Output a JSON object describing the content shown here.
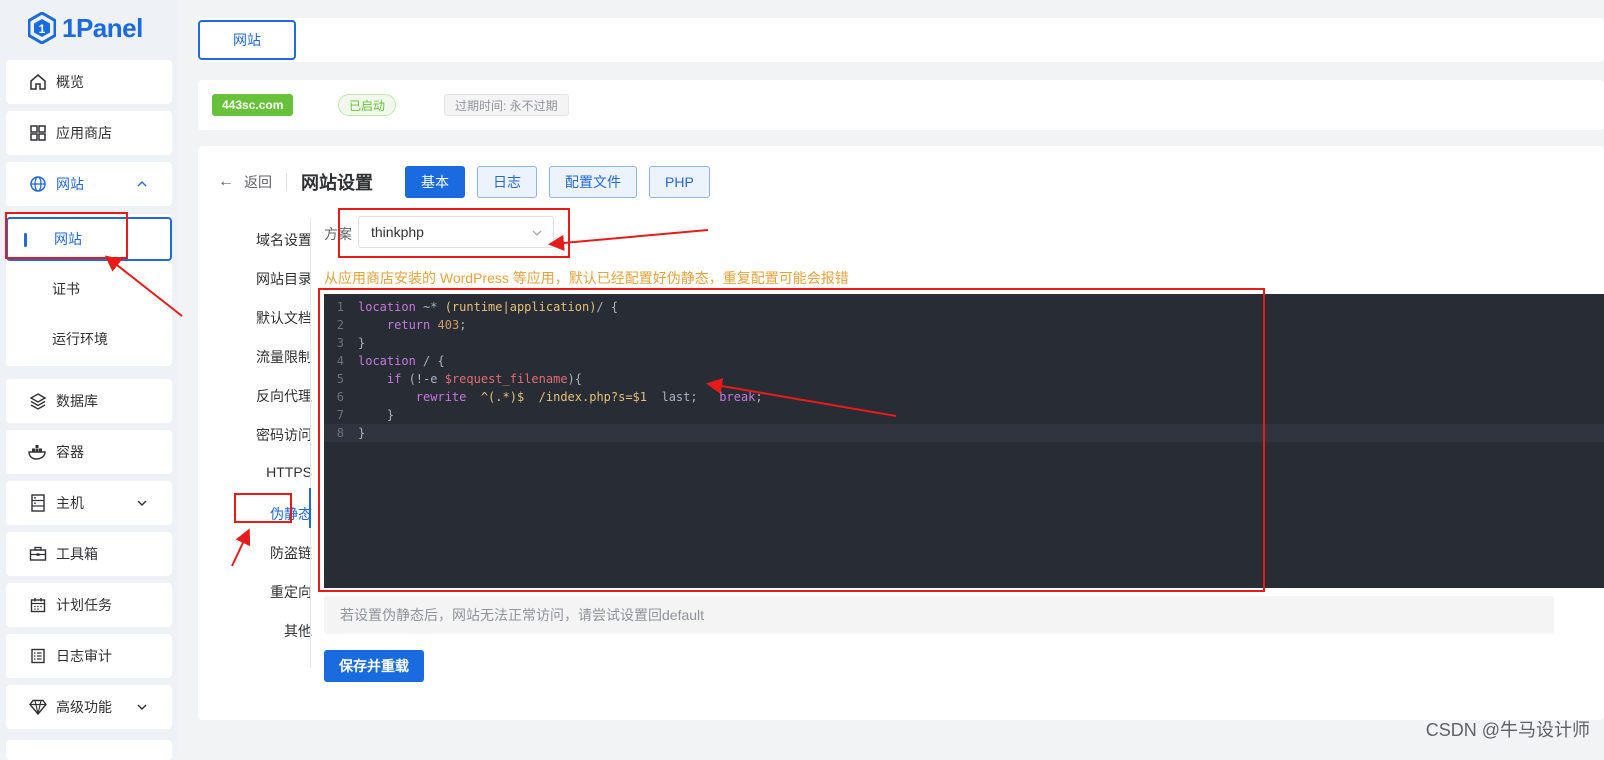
{
  "brand": {
    "name": "1Panel"
  },
  "sidebar": {
    "items": [
      {
        "label": "概览",
        "icon": "home-icon"
      },
      {
        "label": "应用商店",
        "icon": "app-grid-icon"
      },
      {
        "label": "网站",
        "icon": "globe-icon"
      },
      {
        "label": "数据库",
        "icon": "layers-icon"
      },
      {
        "label": "容器",
        "icon": "docker-icon"
      },
      {
        "label": "主机",
        "icon": "server-icon"
      },
      {
        "label": "工具箱",
        "icon": "toolbox-icon"
      },
      {
        "label": "计划任务",
        "icon": "calendar-icon"
      },
      {
        "label": "日志审计",
        "icon": "log-icon"
      },
      {
        "label": "高级功能",
        "icon": "diamond-icon"
      }
    ],
    "website_sub": [
      "网站",
      "证书",
      "运行环境"
    ]
  },
  "tabs": {
    "website": "网站"
  },
  "site": {
    "domain": "443sc.com",
    "status": "已启动",
    "expire": "过期时间: 永不过期"
  },
  "header": {
    "back": "返回",
    "title": "网站设置",
    "buttons": [
      "基本",
      "日志",
      "配置文件",
      "PHP"
    ]
  },
  "settings_menu": [
    "域名设置",
    "网站目录",
    "默认文档",
    "流量限制",
    "反向代理",
    "密码访问",
    "HTTPS",
    "伪静态",
    "防盗链",
    "重定向",
    "其他"
  ],
  "rewrite": {
    "scheme_label": "方案",
    "scheme_value": "thinkphp",
    "warning": "从应用商店安装的 WordPress 等应用，默认已经配置好伪静态，重复配置可能会报错",
    "code_lines": [
      "location ~* (runtime|application)/ {",
      "    return 403;",
      "}",
      "location / {",
      "    if (!-e $request_filename){",
      "        rewrite  ^(.*)$  /index.php?s=$1  last;   break;",
      "    }",
      "}"
    ],
    "tip": "若设置伪静态后，网站无法正常访问，请尝试设置回default",
    "save": "保存并重载"
  },
  "watermark": "CSDN @牛马设计师",
  "colors": {
    "primary": "#1a6ae0",
    "annotation": "#e81b1b",
    "success": "#67c23a",
    "warning": "#e6a23c",
    "editor_bg": "#282c34"
  }
}
